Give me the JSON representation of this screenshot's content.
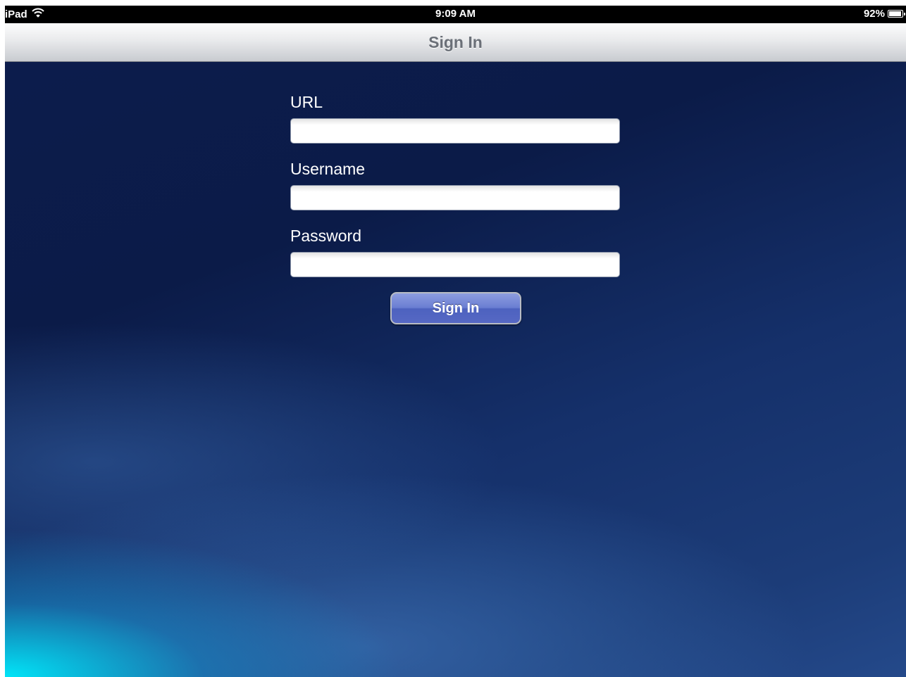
{
  "status_bar": {
    "device_label": "iPad",
    "wifi_icon": "wifi-icon",
    "time": "9:09 AM",
    "battery_percent_text": "92%",
    "battery_level": 0.92,
    "battery_icon": "battery-icon"
  },
  "nav_bar": {
    "title": "Sign In"
  },
  "form": {
    "url": {
      "label": "URL",
      "value": ""
    },
    "username": {
      "label": "Username",
      "value": ""
    },
    "password": {
      "label": "Password",
      "value": ""
    },
    "submit_label": "Sign In"
  },
  "colors": {
    "background_dark": "#0b1b48",
    "background_glow": "#00eeff",
    "button_blue": "#5b6ec8",
    "nav_title": "#6b7078"
  }
}
